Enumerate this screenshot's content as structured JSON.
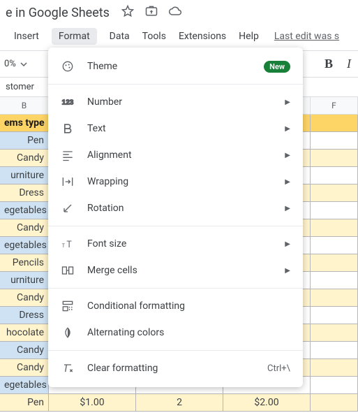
{
  "title_partial": "e in Google Sheets",
  "menu": {
    "insert": "Insert",
    "format": "Format",
    "data": "Data",
    "tools": "Tools",
    "extensions": "Extensions",
    "help": "Help",
    "last_edit": "Last edit was s"
  },
  "toolbar": {
    "zoom": "0%",
    "bold": "B",
    "italic": "I"
  },
  "name_box": "stomer",
  "columns": [
    "B",
    "F"
  ],
  "rows": [
    {
      "b": "ems type",
      "header": true
    },
    {
      "b": "Pen"
    },
    {
      "b": "Candy",
      "alt": true
    },
    {
      "b": "urniture"
    },
    {
      "b": "Dress",
      "alt": true
    },
    {
      "b": "egetables"
    },
    {
      "b": "Candy",
      "alt": true
    },
    {
      "b": "egetables"
    },
    {
      "b": "Pencils",
      "alt": true
    },
    {
      "b": "urniture"
    },
    {
      "b": "Candy",
      "alt": true
    },
    {
      "b": "Dress"
    },
    {
      "b": "hocolate",
      "alt": true
    },
    {
      "b": "Candy"
    },
    {
      "b": "Candy",
      "alt": true
    },
    {
      "b": "egetables"
    },
    {
      "b": "Pen",
      "c": "$1.00",
      "d": "2",
      "e": "$2.00",
      "alt": true
    }
  ],
  "dropdown": {
    "theme": "Theme",
    "new_badge": "New",
    "number": "Number",
    "text": "Text",
    "alignment": "Alignment",
    "wrapping": "Wrapping",
    "rotation": "Rotation",
    "font_size": "Font size",
    "merge_cells": "Merge cells",
    "conditional_formatting": "Conditional formatting",
    "alternating_colors": "Alternating colors",
    "clear_formatting": "Clear formatting",
    "clear_shortcut": "Ctrl+\\"
  }
}
